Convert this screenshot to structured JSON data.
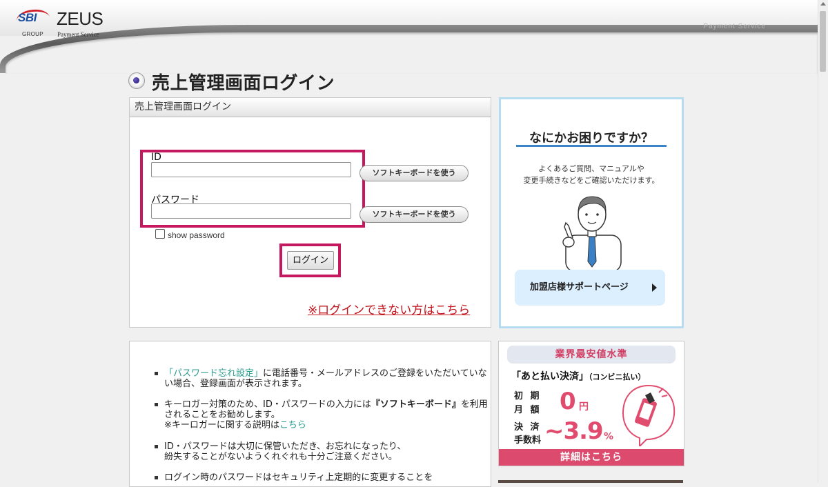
{
  "header": {
    "logo": {
      "sbi": "SBI",
      "group": "GROUP",
      "zeus": "ZEUS",
      "payment_service": "Payment Service"
    },
    "right_text": "Payment Service"
  },
  "page": {
    "title": "売上管理画面ログイン"
  },
  "login_panel": {
    "header": "売上管理画面ログイン",
    "id_label": "ID",
    "id_value": "",
    "password_label": "パスワード",
    "password_value": "",
    "soft_keyboard_label": "ソフトキーボードを使う",
    "show_password_label": "show password",
    "show_password_checked": false,
    "login_button": "ログイン",
    "cant_login_link": "※ログインできない方はこちら",
    "highlight_color": "#c6185e"
  },
  "info": {
    "item1_link": "「パスワード忘れ設定」",
    "item1_text": "に電話番号・メールアドレスのご登録をいただいていない場合、登録画面が表示されます。",
    "item2_text_a": "キーロガー対策のため、ID・パスワードの入力には",
    "item2_bold": "『ソフトキーボード』",
    "item2_text_b": "を利用されることをお勧めします。",
    "item2_note": "※キーロガーに関する説明は",
    "item2_link": "こちら",
    "item3_line1": "ID・パスワードは大切に保管いただき、お忘れになったり、",
    "item3_line2": "紛失することがないようくれぐれも十分ご注意ください。",
    "item4_text": "ログイン時のパスワードはセキュリティ上定期的に変更することを"
  },
  "help_banner": {
    "title": "なにかお困りですか？",
    "subtitle_line1": "よくあるご質問、マニュアルや",
    "subtitle_line2": "変更手続きなどをご確認いただけます。",
    "button": "加盟店様サポートページ"
  },
  "ad_banner": {
    "top": "業界最安値水準",
    "main": "「あと払い決済」",
    "main_small": "（コンビニ払い）",
    "label_initial": "初 期",
    "label_monthly": "月 額",
    "zero": "0",
    "yen": "円",
    "label_settle": "決 済",
    "label_fee": "手数料",
    "rate": "~3.9",
    "pct": "%",
    "bottom": "詳細はこちら",
    "colors": {
      "pink": "#e04b6e",
      "bottom_bar": "#dc4a6e"
    }
  }
}
